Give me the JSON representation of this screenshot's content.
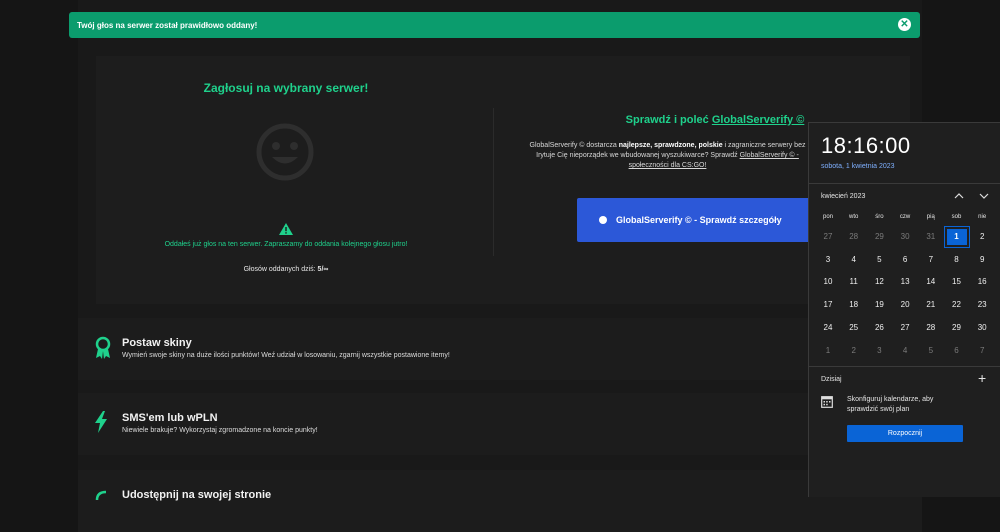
{
  "toast": {
    "message": "Twój głos na serwer został prawidłowo oddany!",
    "close_label": "✕"
  },
  "vote": {
    "title": "Zagłosuj na wybrany serwer!",
    "voted_message": "Oddałeś już głos na ten serwer. Zapraszamy do oddania kolejnego głosu jutro!",
    "count_label": "Głosów oddanych dziś: ",
    "count_value": "5/∞"
  },
  "promo": {
    "title_prefix": "Sprawdź i poleć ",
    "title_brand": "GlobalServerify ©",
    "desc_1": "GlobalServerify © dostarcza ",
    "desc_bold": "najlepsze, sprawdzone, polskie",
    "desc_2": " i zagraniczne serwery bez",
    "desc_3": "Irytuje Cię nieporządek we wbudowanej wyszukiwarce? Sprawdź ",
    "desc_link": "GlobalServerify © -",
    "desc_4": "społeczności dla CS:GO!",
    "button_label": "GlobalServerify © - Sprawdź szczegóły"
  },
  "features": [
    {
      "title": "Postaw skiny",
      "desc": "Wymień swoje skiny na duże ilości punktów! Weź udział w losowaniu, zgarnij wszystkie postawione itemy!"
    },
    {
      "title": "SMS'em lub wPLN",
      "desc": "Niewiele brakuje? Wykorzystaj zgromadzone na koncie punkty!"
    },
    {
      "title": "Udostępnij na swojej stronie",
      "desc": ""
    }
  ],
  "calendar": {
    "time": "18:16:00",
    "date": "sobota, 1 kwietnia 2023",
    "month_label": "kwiecień 2023",
    "weekdays": [
      "pon",
      "wto",
      "śro",
      "czw",
      "pią",
      "sob",
      "nie"
    ],
    "weeks": [
      [
        "27",
        "28",
        "29",
        "30",
        "31",
        "1",
        "2"
      ],
      [
        "3",
        "4",
        "5",
        "6",
        "7",
        "8",
        "9"
      ],
      [
        "10",
        "11",
        "12",
        "13",
        "14",
        "15",
        "16"
      ],
      [
        "17",
        "18",
        "19",
        "20",
        "21",
        "22",
        "23"
      ],
      [
        "24",
        "25",
        "26",
        "27",
        "28",
        "29",
        "30"
      ],
      [
        "1",
        "2",
        "3",
        "4",
        "5",
        "6",
        "7"
      ]
    ],
    "today_index": [
      0,
      5
    ],
    "other_month": [
      [
        0,
        0
      ],
      [
        0,
        1
      ],
      [
        0,
        2
      ],
      [
        0,
        3
      ],
      [
        0,
        4
      ],
      [
        5,
        0
      ],
      [
        5,
        1
      ],
      [
        5,
        2
      ],
      [
        5,
        3
      ],
      [
        5,
        4
      ],
      [
        5,
        5
      ],
      [
        5,
        6
      ]
    ],
    "today_label": "Dzisiaj",
    "add_label": "+",
    "config_message": "Skonfiguruj kalendarze, aby sprawdzić swój plan",
    "start_button": "Rozpocznij"
  },
  "colors": {
    "accent": "#1fd18c",
    "toast": "#0b9c6d",
    "cta": "#2c58d8",
    "calendar_accent": "#0a64d6"
  }
}
